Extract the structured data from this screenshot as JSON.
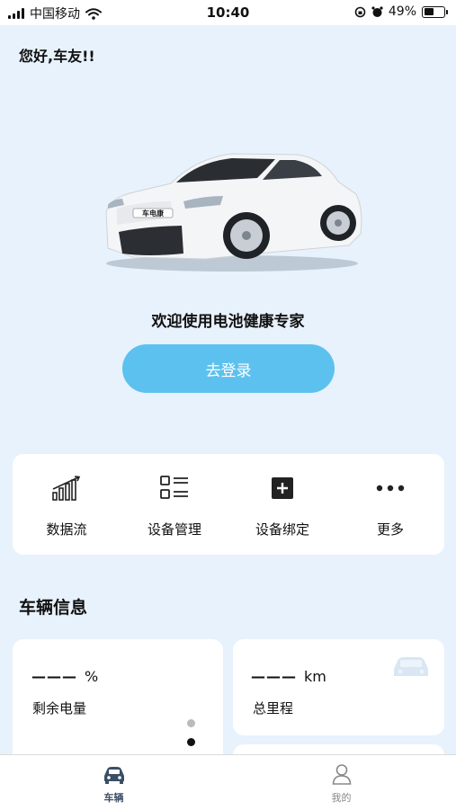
{
  "status": {
    "carrier": "中国移动",
    "time": "10:40",
    "battery": "49%",
    "battery_level": 0.49
  },
  "greeting": "您好,车友!!",
  "car_badge": "车电康",
  "welcome": "欢迎使用电池健康专家",
  "login_label": "去登录",
  "quick_actions": [
    {
      "label": "数据流",
      "icon": "bar-chart-icon"
    },
    {
      "label": "设备管理",
      "icon": "list-icon"
    },
    {
      "label": "设备绑定",
      "icon": "plus-square-icon"
    },
    {
      "label": "更多",
      "icon": "more-dots-icon"
    }
  ],
  "vehicle_section_title": "车辆信息",
  "battery_card": {
    "value": "———",
    "unit": "%",
    "label": "剩余电量"
  },
  "mileage_card": {
    "value": "———",
    "unit": "km",
    "label": "总里程"
  },
  "tabs": [
    {
      "label": "车辆",
      "icon": "car-icon",
      "active": true
    },
    {
      "label": "我的",
      "icon": "profile-icon",
      "active": false
    }
  ],
  "colors": {
    "accent": "#5dc1ef",
    "background": "#e8f2fc",
    "active_tab": "#3a4f66",
    "inactive_tab": "#888888"
  }
}
